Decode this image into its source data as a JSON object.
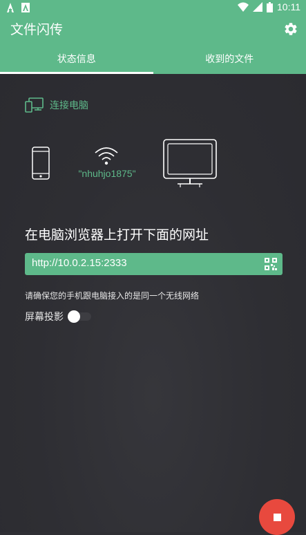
{
  "status_bar": {
    "time": "10:11",
    "icons": [
      "notification-a-icon",
      "notification-b-icon",
      "wifi-icon",
      "cell-signal-icon",
      "battery-icon"
    ]
  },
  "app": {
    "title": "文件闪传",
    "settings_icon": "gear-icon"
  },
  "tabs": [
    {
      "label": "状态信息",
      "selected": true
    },
    {
      "label": "收到的文件",
      "selected": false
    }
  ],
  "connect": {
    "section_label": "连接电脑",
    "section_icon": "devices-icon",
    "wifi_name": "\"nhuhjo1875\"",
    "instruction": "在电脑浏览器上打开下面的网址",
    "url": "http://10.0.2.15:2333",
    "note": "请确保您的手机跟电脑接入的是同一个无线网络",
    "projection_label": "屏幕投影",
    "projection_enabled": false
  },
  "colors": {
    "accent": "#5eb98a",
    "background": "#2f2f34",
    "fab": "#e8493e"
  },
  "fab": {
    "icon": "stop-icon"
  }
}
